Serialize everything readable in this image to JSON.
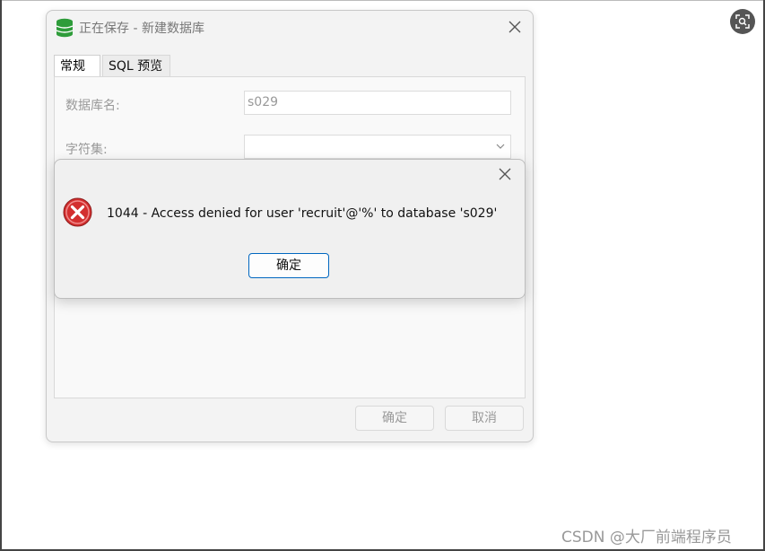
{
  "main_dialog": {
    "title": "正在保存 - 新建数据库",
    "tabs": [
      {
        "label": "常规"
      },
      {
        "label": "SQL 预览"
      }
    ],
    "fields": {
      "db_name_label": "数据库名:",
      "db_name_value": "s029",
      "charset_label": "字符集:",
      "charset_value": ""
    },
    "ok_label": "确定",
    "cancel_label": "取消"
  },
  "alert": {
    "message": "1044 - Access denied for user 'recruit'@'%' to database 's029'",
    "ok_label": "确定"
  },
  "watermark": "CSDN @大厂前端程序员",
  "colors": {
    "accent_blue": "#0067c0",
    "error_red": "#d32f2f",
    "db_icon_green": "#2e9c3a"
  }
}
